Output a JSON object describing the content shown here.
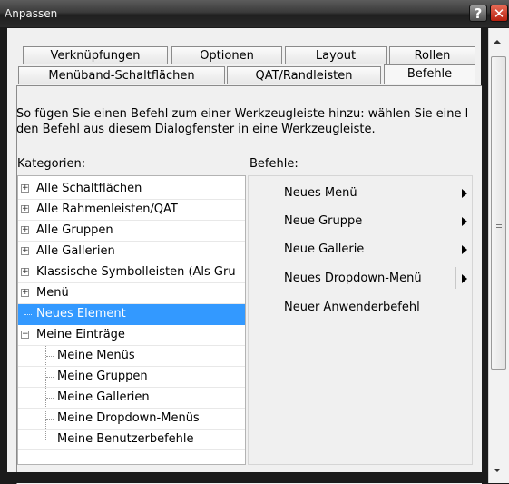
{
  "window": {
    "title": "Anpassen",
    "help_label": "?",
    "close_label": "✕"
  },
  "tabs_row1": [
    "Verknüpfungen",
    "Optionen",
    "Layout",
    "Rollen"
  ],
  "tabs_row2": [
    "Menüband-Schaltflächen",
    "QAT/Randleisten",
    "Befehle"
  ],
  "active_tab": "Befehle",
  "instruction": {
    "line1": "So fügen Sie einen Befehl zum einer Werkzeugleiste hinzu: wählen Sie eine l",
    "line2": "den Befehl aus diesem Dialogfenster in eine Werkzeugleiste."
  },
  "labels": {
    "categories": "Kategorien:",
    "commands": "Befehle:"
  },
  "categories": [
    {
      "label": "Alle Schaltflächen",
      "expander": "+"
    },
    {
      "label": "Alle Rahmenleisten/QAT",
      "expander": "+"
    },
    {
      "label": "Alle Gruppen",
      "expander": "+"
    },
    {
      "label": "Alle Gallerien",
      "expander": "+"
    },
    {
      "label": "Klassische Symbolleisten (Als Gru",
      "expander": "+"
    },
    {
      "label": "Menü",
      "expander": "+"
    },
    {
      "label": "Neues Element",
      "selected": true
    },
    {
      "label": "Meine Einträge",
      "expander": "−"
    },
    {
      "label": "Meine Menüs",
      "child": true
    },
    {
      "label": "Meine Gruppen",
      "child": true
    },
    {
      "label": "Meine Gallerien",
      "child": true
    },
    {
      "label": "Meine Dropdown-Menüs",
      "child": true
    },
    {
      "label": "Meine Benutzerbefehle",
      "child": true
    }
  ],
  "commands": [
    {
      "label": "Neues Menü",
      "submenu": true
    },
    {
      "label": "Neue Gruppe",
      "submenu": true
    },
    {
      "label": "Neue Gallerie",
      "submenu": true
    },
    {
      "label": "Neues Dropdown-Menü",
      "submenu": true,
      "split": true
    },
    {
      "label": "Neuer Anwenderbefehl",
      "submenu": false
    }
  ]
}
